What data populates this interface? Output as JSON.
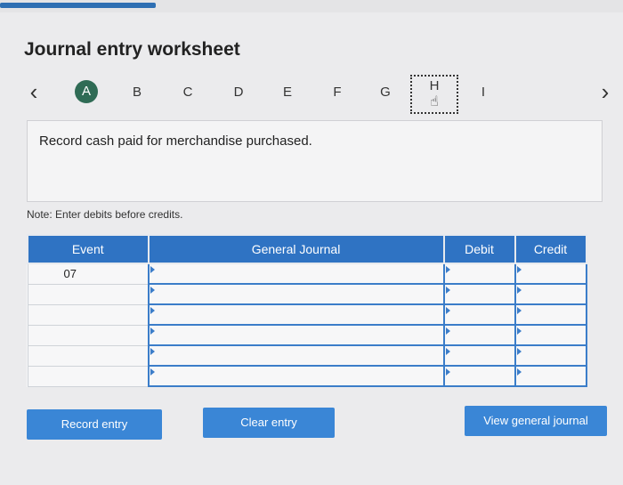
{
  "title": "Journal entry worksheet",
  "nav": {
    "prev_icon": "‹",
    "next_icon": "›",
    "tabs": [
      "A",
      "B",
      "C",
      "D",
      "E",
      "F",
      "G",
      "H",
      "I"
    ],
    "active_tab": "A"
  },
  "prompt": "Record cash paid for merchandise purchased.",
  "note": "Note: Enter debits before credits.",
  "table": {
    "headers": {
      "event": "Event",
      "general_journal": "General Journal",
      "debit": "Debit",
      "credit": "Credit"
    },
    "rows": [
      {
        "event": "07"
      },
      {
        "event": ""
      },
      {
        "event": ""
      },
      {
        "event": ""
      },
      {
        "event": ""
      },
      {
        "event": ""
      }
    ]
  },
  "buttons": {
    "record": "Record entry",
    "clear": "Clear entry",
    "view": "View general journal"
  },
  "colors": {
    "accent": "#2f73c3",
    "active_tab": "#2f6b55"
  }
}
